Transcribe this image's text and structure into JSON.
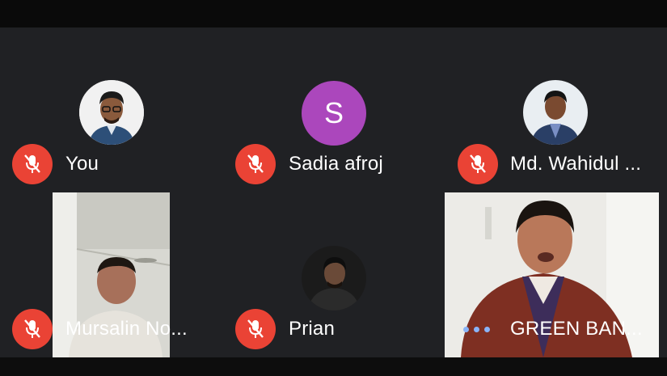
{
  "colors": {
    "stage_bg": "#202124",
    "mute_red": "#ea4335",
    "avatar_purple": "#ab47bc",
    "speaking_dots": "#8ab4f8"
  },
  "participants": [
    {
      "name": "You",
      "avatar": "photo",
      "muted": true
    },
    {
      "name": "Sadia afroj",
      "avatar": "letter",
      "initial": "S",
      "muted": true
    },
    {
      "name": "Md. Wahidul ...",
      "avatar": "photo",
      "muted": true
    },
    {
      "name": "Mursalin No...",
      "avatar": "video",
      "muted": true
    },
    {
      "name": "Prian",
      "avatar": "photo",
      "muted": true
    },
    {
      "name": "GREEN BAN...",
      "avatar": "video",
      "muted": false,
      "status_icon": "more-dots-icon"
    }
  ]
}
